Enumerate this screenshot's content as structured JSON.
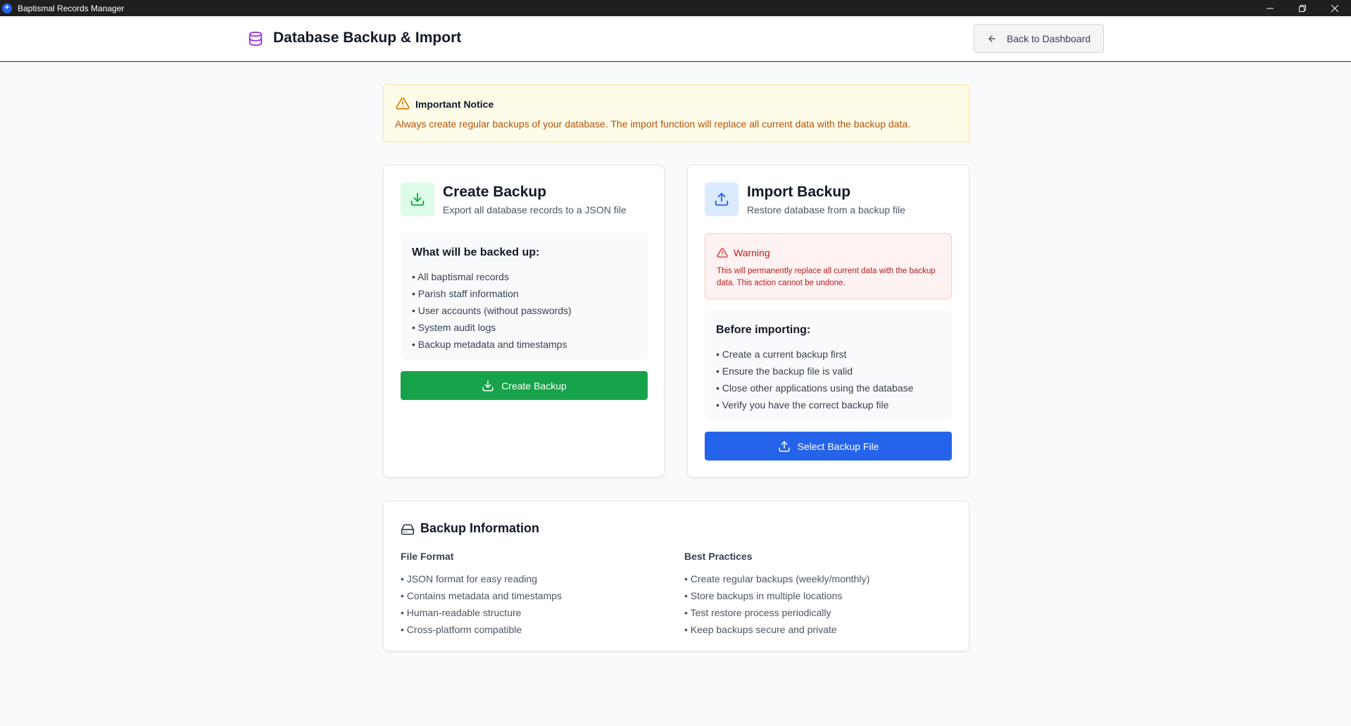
{
  "window": {
    "title": "Baptismal Records Manager",
    "app_icon_glyph": "+"
  },
  "header": {
    "title": "Database Backup & Import",
    "icon": "database-icon",
    "back_label": "Back to Dashboard"
  },
  "notice": {
    "title": "Important Notice",
    "text": "Always create regular backups of your database. The import function will replace all current data with the backup data."
  },
  "create_backup": {
    "title": "Create Backup",
    "subtitle": "Export all database records to a JSON file",
    "list_title": "What will be backed up:",
    "items": [
      "• All baptismal records",
      "• Parish staff information",
      "• User accounts (without passwords)",
      "• System audit logs",
      "• Backup metadata and timestamps"
    ],
    "button_label": "Create Backup"
  },
  "import_backup": {
    "title": "Import Backup",
    "subtitle": "Restore database from a backup file",
    "warning_title": "Warning",
    "warning_text": "This will permanently replace all current data with the backup data. This action cannot be undone.",
    "list_title": "Before importing:",
    "items": [
      "• Create a current backup first",
      "• Ensure the backup file is valid",
      "• Close other applications using the database",
      "• Verify you have the correct backup file"
    ],
    "button_label": "Select Backup File"
  },
  "backup_info": {
    "title": "Backup Information",
    "file_format": {
      "title": "File Format",
      "items": [
        "• JSON format for easy reading",
        "• Contains metadata and timestamps",
        "• Human-readable structure",
        "• Cross-platform compatible"
      ]
    },
    "best_practices": {
      "title": "Best Practices",
      "items": [
        "• Create regular backups (weekly/monthly)",
        "• Store backups in multiple locations",
        "• Test restore process periodically",
        "• Keep backups secure and private"
      ]
    }
  },
  "colors": {
    "accent_purple": "#9333ea",
    "green": "#16a34a",
    "blue": "#2563eb",
    "warning_amber": "#b45309",
    "danger_red": "#b91c1c"
  }
}
